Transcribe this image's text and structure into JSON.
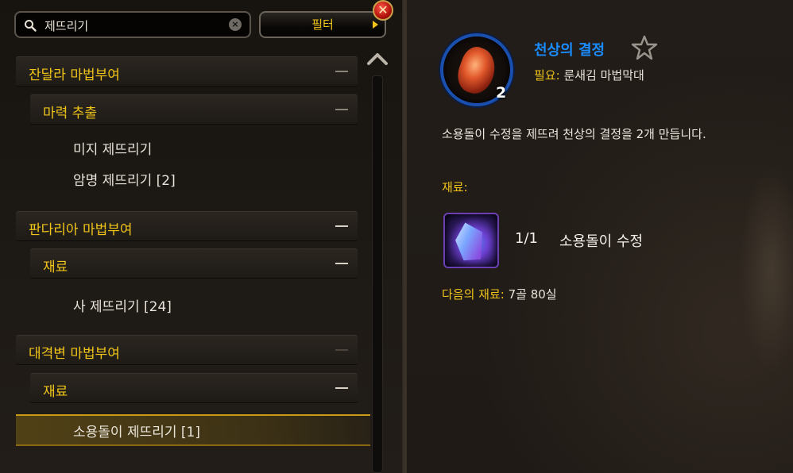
{
  "search": {
    "value": "제뜨리기",
    "clear_icon": "x-circle-icon"
  },
  "filter": {
    "label": "필터"
  },
  "close": {
    "label": "✕",
    "icon": "close-icon",
    "color": "#c21a10"
  },
  "categories": [
    {
      "label": "잔달라 마법부여",
      "collapse_symbol": "−",
      "subcategories": [
        {
          "label": "마력 추출",
          "collapse_symbol": "−",
          "recipes": [
            "미지 제뜨리기",
            "암명 제뜨리기 [2]"
          ]
        }
      ]
    },
    {
      "label": "판다리아 마법부여",
      "collapse_symbol": "−",
      "subcategories": [
        {
          "label": "재료",
          "collapse_symbol": "−",
          "recipes": [
            "사 제뜨리기 [24]"
          ]
        }
      ]
    },
    {
      "label": "대격변 마법부여",
      "collapse_symbol": "−",
      "subcategories": [
        {
          "label": "재료",
          "collapse_symbol": "−",
          "recipes": [
            "소용돌이 제뜨리기 [1]"
          ]
        }
      ]
    }
  ],
  "selected_recipe": "소용돌이 제뜨리기 [1]",
  "detail": {
    "title": "천상의 결정",
    "icon_count": "2",
    "requires_label": "필요:",
    "requires_value": "룬새김 마법막대",
    "description": "소용돌이 수정을 제뜨려 천상의 결정을 2개 만듭니다.",
    "reagents_label": "재료:",
    "reagents": [
      {
        "count": "1/1",
        "name": "소용돌이 수정",
        "icon": "crystal-icon"
      }
    ],
    "cost_label": "다음의 재료:",
    "cost_value": "7골 80실"
  },
  "colors": {
    "gold_text": "#f0c419",
    "title_blue": "#1a8cff",
    "icon_ring_blue": "#1a4fae",
    "reagent_border_purple": "#6a3fb4",
    "selection": "#c99a18"
  }
}
